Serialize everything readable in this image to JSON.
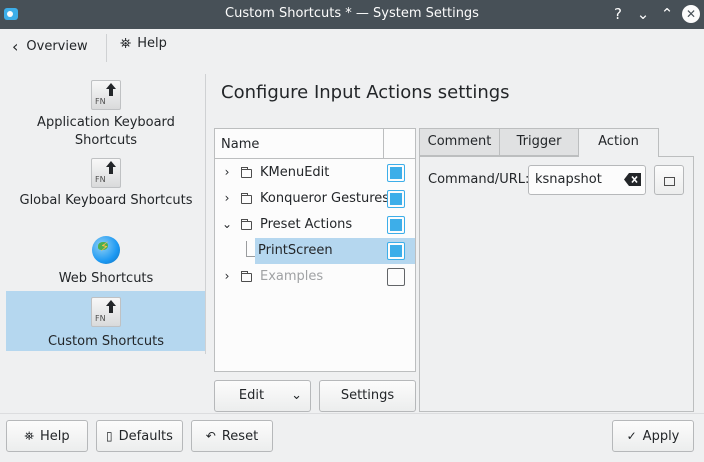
{
  "window": {
    "title": "Custom Shortcuts * — System Settings",
    "buttons": {
      "help": "?",
      "minimize": "⌄",
      "maximize": "⌃",
      "close": "✕"
    }
  },
  "toolbar": {
    "overview": "Overview",
    "help": "Help"
  },
  "sidebar": {
    "items": [
      {
        "label": "Application Keyboard Shortcuts",
        "icon": "keyboard-key-icon",
        "selected": false
      },
      {
        "label": "Global Keyboard Shortcuts",
        "icon": "keyboard-key-icon",
        "selected": false
      },
      {
        "label": "Web Shortcuts",
        "icon": "globe-icon",
        "selected": false
      },
      {
        "label": "Custom Shortcuts",
        "icon": "keyboard-key-icon",
        "selected": true
      }
    ],
    "key_icon_text": "FN"
  },
  "main": {
    "heading": "Configure Input Actions settings",
    "tree": {
      "column_name": "Name",
      "rows": [
        {
          "label": "KMenuEdit",
          "expanded": false,
          "checked": true,
          "enabled": true
        },
        {
          "label": "Konqueror Gestures",
          "expanded": false,
          "checked": true,
          "enabled": true
        },
        {
          "label": "Preset Actions",
          "expanded": true,
          "checked": true,
          "enabled": true
        },
        {
          "label": "PrintScreen",
          "child": true,
          "checked": true,
          "selected": true
        },
        {
          "label": "Examples",
          "expanded": false,
          "checked": false,
          "enabled": false
        }
      ]
    },
    "edit_button": "Edit",
    "settings_button": "Settings",
    "tabs": [
      "Comment",
      "Trigger",
      "Action"
    ],
    "active_tab": "Action",
    "command_label": "Command/URL:",
    "command_value": "ksnapshot"
  },
  "footer": {
    "help": "Help",
    "defaults": "Defaults",
    "reset": "Reset",
    "apply": "Apply"
  },
  "colors": {
    "accent": "#3daee9",
    "selection": "#b5d7ef",
    "titlebar": "#475057"
  }
}
